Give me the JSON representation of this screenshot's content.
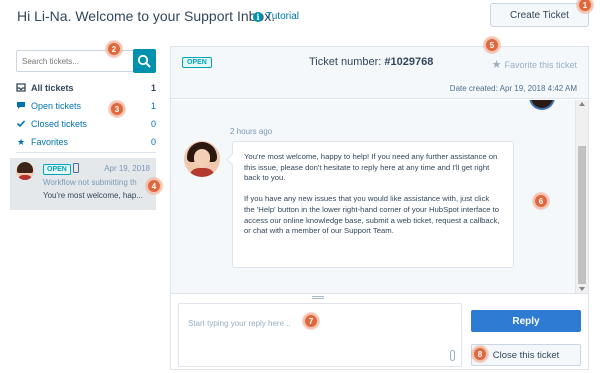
{
  "header": {
    "greeting": "Hi Li-Na. Welcome to your Support Inbox.",
    "tutorial_label": "Tutorial",
    "create_ticket_label": "Create Ticket"
  },
  "search": {
    "placeholder": "Search tickets..."
  },
  "nav": {
    "items": [
      {
        "label": "All tickets",
        "count": "1",
        "icon": "inbox-icon"
      },
      {
        "label": "Open tickets",
        "count": "1",
        "icon": "chat-bubble-icon"
      },
      {
        "label": "Closed tickets",
        "count": "0",
        "icon": "check-icon"
      },
      {
        "label": "Favorites",
        "count": "0",
        "icon": "star-icon"
      }
    ]
  },
  "ticket_list": [
    {
      "status": "OPEN",
      "date": "Apr 19, 2018",
      "subject": "Workflow not submitting th",
      "preview": "You're most welcome, hap..."
    }
  ],
  "ticket": {
    "status": "OPEN",
    "number_label": "Ticket number:",
    "number": "#1029768",
    "favorite_label": "Favorite this ticket",
    "date_created": "Date created: Apr 19, 2018 4:42 AM"
  },
  "message": {
    "time": "2 hours ago",
    "paragraph1": "You're most welcome, happy to help! If you need any further assistance on this issue, please don't hesitate to reply here at any time and I'll get right back to you.",
    "paragraph2": "If you have any new issues that you would like assistance with, just click the 'Help' button in the lower right-hand corner of your HubSpot interface to access our online knowledge base, submit a web ticket, request a callback, or chat with a member of our Support Team."
  },
  "reply": {
    "placeholder": "Start typing your reply here...",
    "reply_label": "Reply",
    "close_label": "Close this ticket"
  },
  "markers": [
    "1",
    "2",
    "3",
    "4",
    "5",
    "6",
    "7",
    "8"
  ],
  "colors": {
    "accent": "#0091ae",
    "reply_button": "#2e7bd3",
    "marker": "#e0683f",
    "open_badge": "#00a4bd"
  }
}
